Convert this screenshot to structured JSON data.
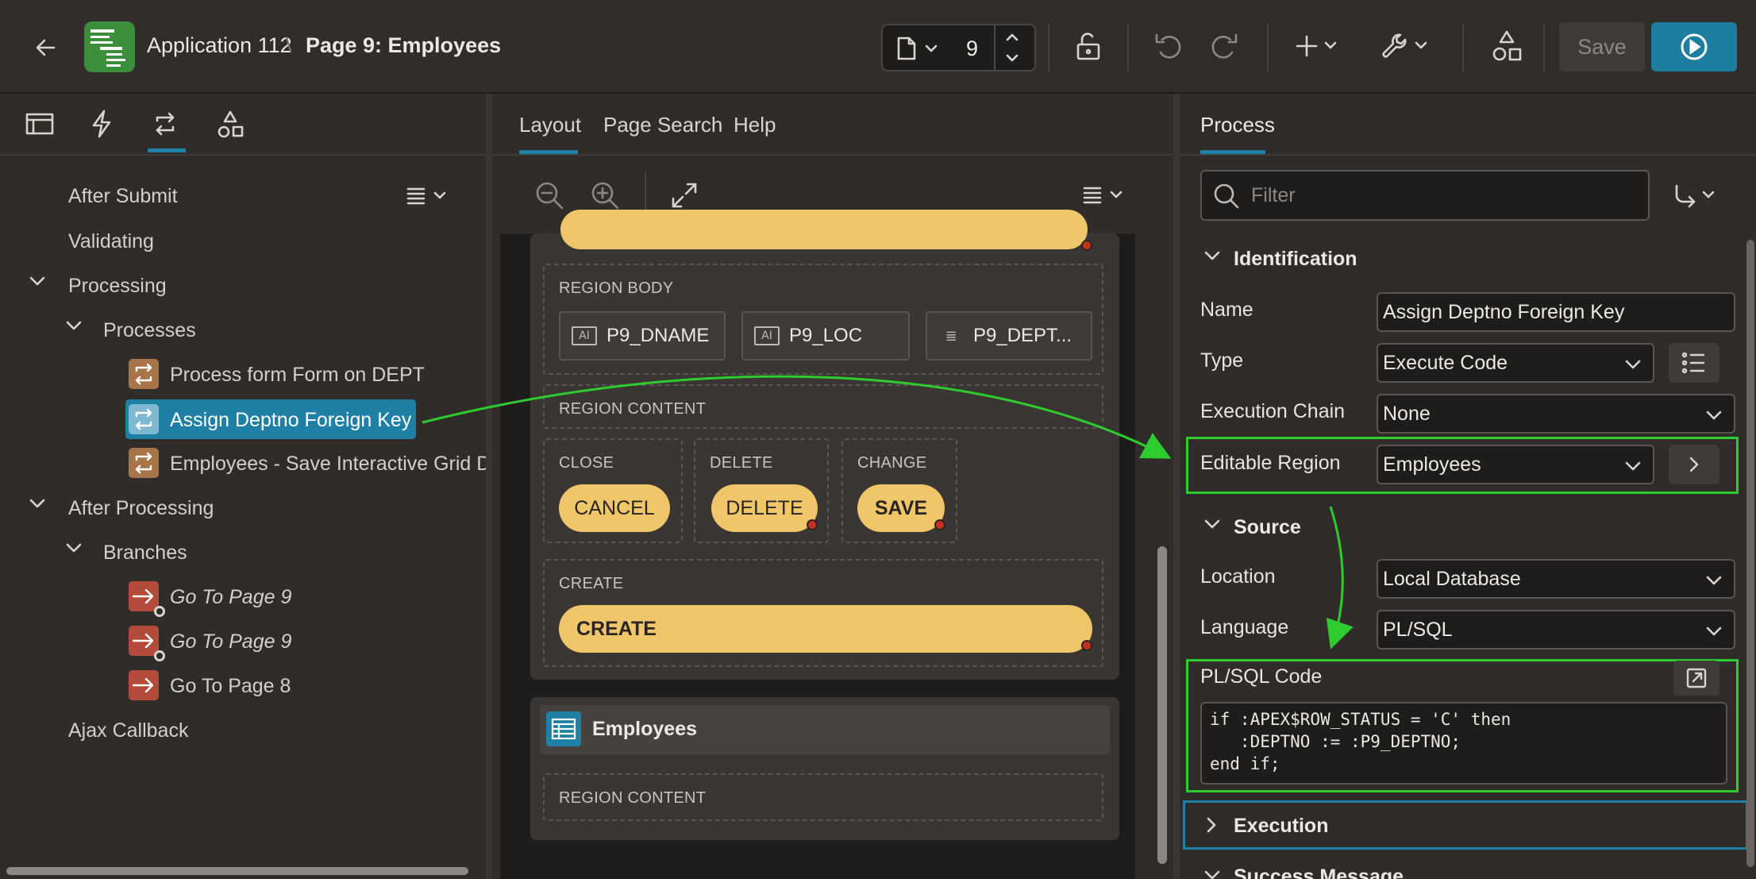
{
  "header": {
    "app_title": "Application 112",
    "separator": "\\",
    "page_title": "Page 9: Employees",
    "page_number": "9",
    "save_label": "Save"
  },
  "left": {
    "tree": [
      {
        "label": "After Submit"
      },
      {
        "label": "Validating"
      },
      {
        "label": "Processing"
      },
      {
        "label": "Processes"
      },
      {
        "label": "Process form Form on DEPT"
      },
      {
        "label": "Assign Deptno Foreign Key"
      },
      {
        "label": "Employees - Save Interactive Grid Data"
      },
      {
        "label": "After Processing"
      },
      {
        "label": "Branches"
      },
      {
        "label": "Go To Page 9"
      },
      {
        "label": "Go To Page 9"
      },
      {
        "label": "Go To Page 8"
      },
      {
        "label": "Ajax Callback"
      }
    ]
  },
  "center": {
    "tabs": [
      "Layout",
      "Page Search",
      "Help"
    ],
    "region_body_label": "REGION BODY",
    "items": [
      "P9_DNAME",
      "P9_LOC",
      "P9_DEPT..."
    ],
    "region_content_label": "REGION CONTENT",
    "close_label": "CLOSE",
    "delete_label": "DELETE",
    "change_label": "CHANGE",
    "cancel_btn": "CANCEL",
    "delete_btn": "DELETE",
    "save_btn": "SAVE",
    "create_label": "CREATE",
    "create_btn": "CREATE",
    "employees_region": "Employees",
    "employees_content_label": "REGION CONTENT"
  },
  "right": {
    "tab": "Process",
    "filter_placeholder": "Filter",
    "identification": "Identification",
    "name_label": "Name",
    "name_value": "Assign Deptno Foreign Key",
    "type_label": "Type",
    "type_value": "Execute Code",
    "exec_chain_label": "Execution Chain",
    "exec_chain_value": "None",
    "editable_region_label": "Editable Region",
    "editable_region_value": "Employees",
    "source": "Source",
    "location_label": "Location",
    "location_value": "Local Database",
    "language_label": "Language",
    "language_value": "PL/SQL",
    "plsql_label": "PL/SQL Code",
    "code": "if :APEX$ROW_STATUS = 'C' then\n   :DEPTNO := :P9_DEPTNO;\nend if;",
    "execution": "Execution",
    "success_message": "Success Message"
  },
  "colors": {
    "accent": "#1f80a6",
    "highlight": "#2ecc2e",
    "button_yellow": "#efc76a"
  }
}
